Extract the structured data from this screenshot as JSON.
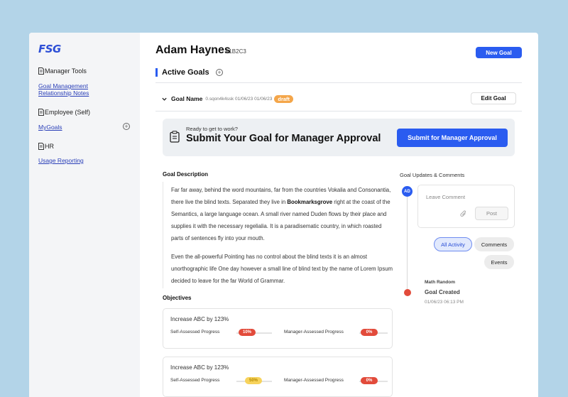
{
  "app": {
    "logo": "FSG"
  },
  "sidebar": {
    "sections": [
      {
        "label": "Manager Tools",
        "links": [
          "Goal Management",
          "Relationship Notes"
        ]
      },
      {
        "label": "Employee (Self)",
        "links": [
          "MyGoals"
        ]
      },
      {
        "label": "HR",
        "links": [
          "Usage Reporting"
        ]
      }
    ]
  },
  "header": {
    "title": "Adam Haynes",
    "employee_id": "A1B2C3",
    "new_goal_label": "New Goal"
  },
  "active_goals": {
    "title": "Active Goals"
  },
  "goal": {
    "name": "Goal Name",
    "meta": "0.sqon4k4ssk 01/06/23 01/06/23",
    "status": "draft",
    "edit_label": "Edit Goal"
  },
  "banner": {
    "subtitle": "Ready to get to work?",
    "title": "Submit Your Goal for Manager Approval",
    "button_label": "Submit for Manager Approval"
  },
  "description": {
    "label": "Goal Description",
    "para1_before": "Far far away, behind the word mountains, far from the countries Vokalia and Consonantia, there live the blind texts. Separated they live in ",
    "para1_bold": "Bookmarksgrove",
    "para1_after": " right at the coast of the Semantics, a large language ocean. A small river named Duden flows by their place and supplies it with the necessary regelialia. It is a paradisematic country, in which roasted parts of sentences fly into your mouth.",
    "para2": "Even the all-powerful Pointing has no control about the blind texts it is an almost unorthographic life One day however a small line of blind text by the name of Lorem Ipsum decided to leave for the far World of Grammar."
  },
  "objectives": {
    "label": "Objectives",
    "self_label": "Self-Assessed Progress",
    "manager_label": "Manager-Assessed Progress",
    "items": [
      {
        "title": "Increase ABC by 123%",
        "self_progress": "10%",
        "manager_progress": "0%"
      },
      {
        "title": "Increase ABC by 123%",
        "self_progress": "50%",
        "manager_progress": "0%"
      }
    ]
  },
  "updates": {
    "label": "Goal Updates & Comments",
    "avatar_initials": "AD",
    "comment_placeholder": "Leave Comment",
    "post_label": "Post",
    "filters": [
      "All Activity",
      "Comments",
      "Events"
    ],
    "event": {
      "author": "Math Random",
      "title": "Goal Created",
      "time": "01/06/23 06:13 PM"
    }
  },
  "colors": {
    "accent": "#2a5cf0",
    "draft": "#f4a64a",
    "danger": "#e24b3b",
    "warning": "#f7d35c"
  }
}
